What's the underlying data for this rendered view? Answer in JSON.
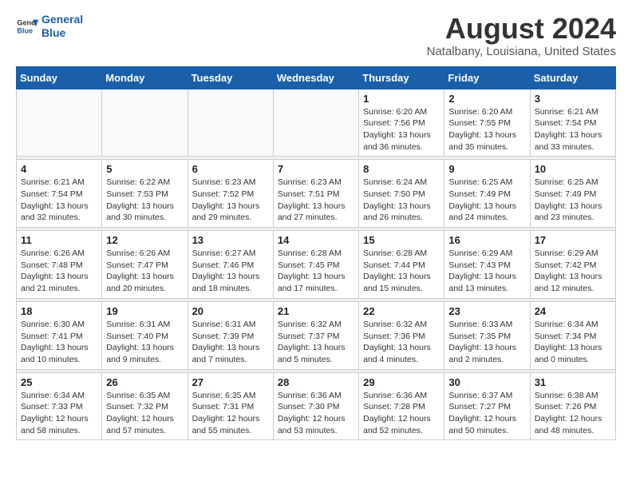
{
  "header": {
    "logo_line1": "General",
    "logo_line2": "Blue",
    "month_title": "August 2024",
    "location": "Natalbany, Louisiana, United States"
  },
  "weekdays": [
    "Sunday",
    "Monday",
    "Tuesday",
    "Wednesday",
    "Thursday",
    "Friday",
    "Saturday"
  ],
  "weeks": [
    [
      {
        "day": "",
        "info": ""
      },
      {
        "day": "",
        "info": ""
      },
      {
        "day": "",
        "info": ""
      },
      {
        "day": "",
        "info": ""
      },
      {
        "day": "1",
        "info": "Sunrise: 6:20 AM\nSunset: 7:56 PM\nDaylight: 13 hours\nand 36 minutes."
      },
      {
        "day": "2",
        "info": "Sunrise: 6:20 AM\nSunset: 7:55 PM\nDaylight: 13 hours\nand 35 minutes."
      },
      {
        "day": "3",
        "info": "Sunrise: 6:21 AM\nSunset: 7:54 PM\nDaylight: 13 hours\nand 33 minutes."
      }
    ],
    [
      {
        "day": "4",
        "info": "Sunrise: 6:21 AM\nSunset: 7:54 PM\nDaylight: 13 hours\nand 32 minutes."
      },
      {
        "day": "5",
        "info": "Sunrise: 6:22 AM\nSunset: 7:53 PM\nDaylight: 13 hours\nand 30 minutes."
      },
      {
        "day": "6",
        "info": "Sunrise: 6:23 AM\nSunset: 7:52 PM\nDaylight: 13 hours\nand 29 minutes."
      },
      {
        "day": "7",
        "info": "Sunrise: 6:23 AM\nSunset: 7:51 PM\nDaylight: 13 hours\nand 27 minutes."
      },
      {
        "day": "8",
        "info": "Sunrise: 6:24 AM\nSunset: 7:50 PM\nDaylight: 13 hours\nand 26 minutes."
      },
      {
        "day": "9",
        "info": "Sunrise: 6:25 AM\nSunset: 7:49 PM\nDaylight: 13 hours\nand 24 minutes."
      },
      {
        "day": "10",
        "info": "Sunrise: 6:25 AM\nSunset: 7:49 PM\nDaylight: 13 hours\nand 23 minutes."
      }
    ],
    [
      {
        "day": "11",
        "info": "Sunrise: 6:26 AM\nSunset: 7:48 PM\nDaylight: 13 hours\nand 21 minutes."
      },
      {
        "day": "12",
        "info": "Sunrise: 6:26 AM\nSunset: 7:47 PM\nDaylight: 13 hours\nand 20 minutes."
      },
      {
        "day": "13",
        "info": "Sunrise: 6:27 AM\nSunset: 7:46 PM\nDaylight: 13 hours\nand 18 minutes."
      },
      {
        "day": "14",
        "info": "Sunrise: 6:28 AM\nSunset: 7:45 PM\nDaylight: 13 hours\nand 17 minutes."
      },
      {
        "day": "15",
        "info": "Sunrise: 6:28 AM\nSunset: 7:44 PM\nDaylight: 13 hours\nand 15 minutes."
      },
      {
        "day": "16",
        "info": "Sunrise: 6:29 AM\nSunset: 7:43 PM\nDaylight: 13 hours\nand 13 minutes."
      },
      {
        "day": "17",
        "info": "Sunrise: 6:29 AM\nSunset: 7:42 PM\nDaylight: 13 hours\nand 12 minutes."
      }
    ],
    [
      {
        "day": "18",
        "info": "Sunrise: 6:30 AM\nSunset: 7:41 PM\nDaylight: 13 hours\nand 10 minutes."
      },
      {
        "day": "19",
        "info": "Sunrise: 6:31 AM\nSunset: 7:40 PM\nDaylight: 13 hours\nand 9 minutes."
      },
      {
        "day": "20",
        "info": "Sunrise: 6:31 AM\nSunset: 7:39 PM\nDaylight: 13 hours\nand 7 minutes."
      },
      {
        "day": "21",
        "info": "Sunrise: 6:32 AM\nSunset: 7:37 PM\nDaylight: 13 hours\nand 5 minutes."
      },
      {
        "day": "22",
        "info": "Sunrise: 6:32 AM\nSunset: 7:36 PM\nDaylight: 13 hours\nand 4 minutes."
      },
      {
        "day": "23",
        "info": "Sunrise: 6:33 AM\nSunset: 7:35 PM\nDaylight: 13 hours\nand 2 minutes."
      },
      {
        "day": "24",
        "info": "Sunrise: 6:34 AM\nSunset: 7:34 PM\nDaylight: 13 hours\nand 0 minutes."
      }
    ],
    [
      {
        "day": "25",
        "info": "Sunrise: 6:34 AM\nSunset: 7:33 PM\nDaylight: 12 hours\nand 58 minutes."
      },
      {
        "day": "26",
        "info": "Sunrise: 6:35 AM\nSunset: 7:32 PM\nDaylight: 12 hours\nand 57 minutes."
      },
      {
        "day": "27",
        "info": "Sunrise: 6:35 AM\nSunset: 7:31 PM\nDaylight: 12 hours\nand 55 minutes."
      },
      {
        "day": "28",
        "info": "Sunrise: 6:36 AM\nSunset: 7:30 PM\nDaylight: 12 hours\nand 53 minutes."
      },
      {
        "day": "29",
        "info": "Sunrise: 6:36 AM\nSunset: 7:28 PM\nDaylight: 12 hours\nand 52 minutes."
      },
      {
        "day": "30",
        "info": "Sunrise: 6:37 AM\nSunset: 7:27 PM\nDaylight: 12 hours\nand 50 minutes."
      },
      {
        "day": "31",
        "info": "Sunrise: 6:38 AM\nSunset: 7:26 PM\nDaylight: 12 hours\nand 48 minutes."
      }
    ]
  ]
}
